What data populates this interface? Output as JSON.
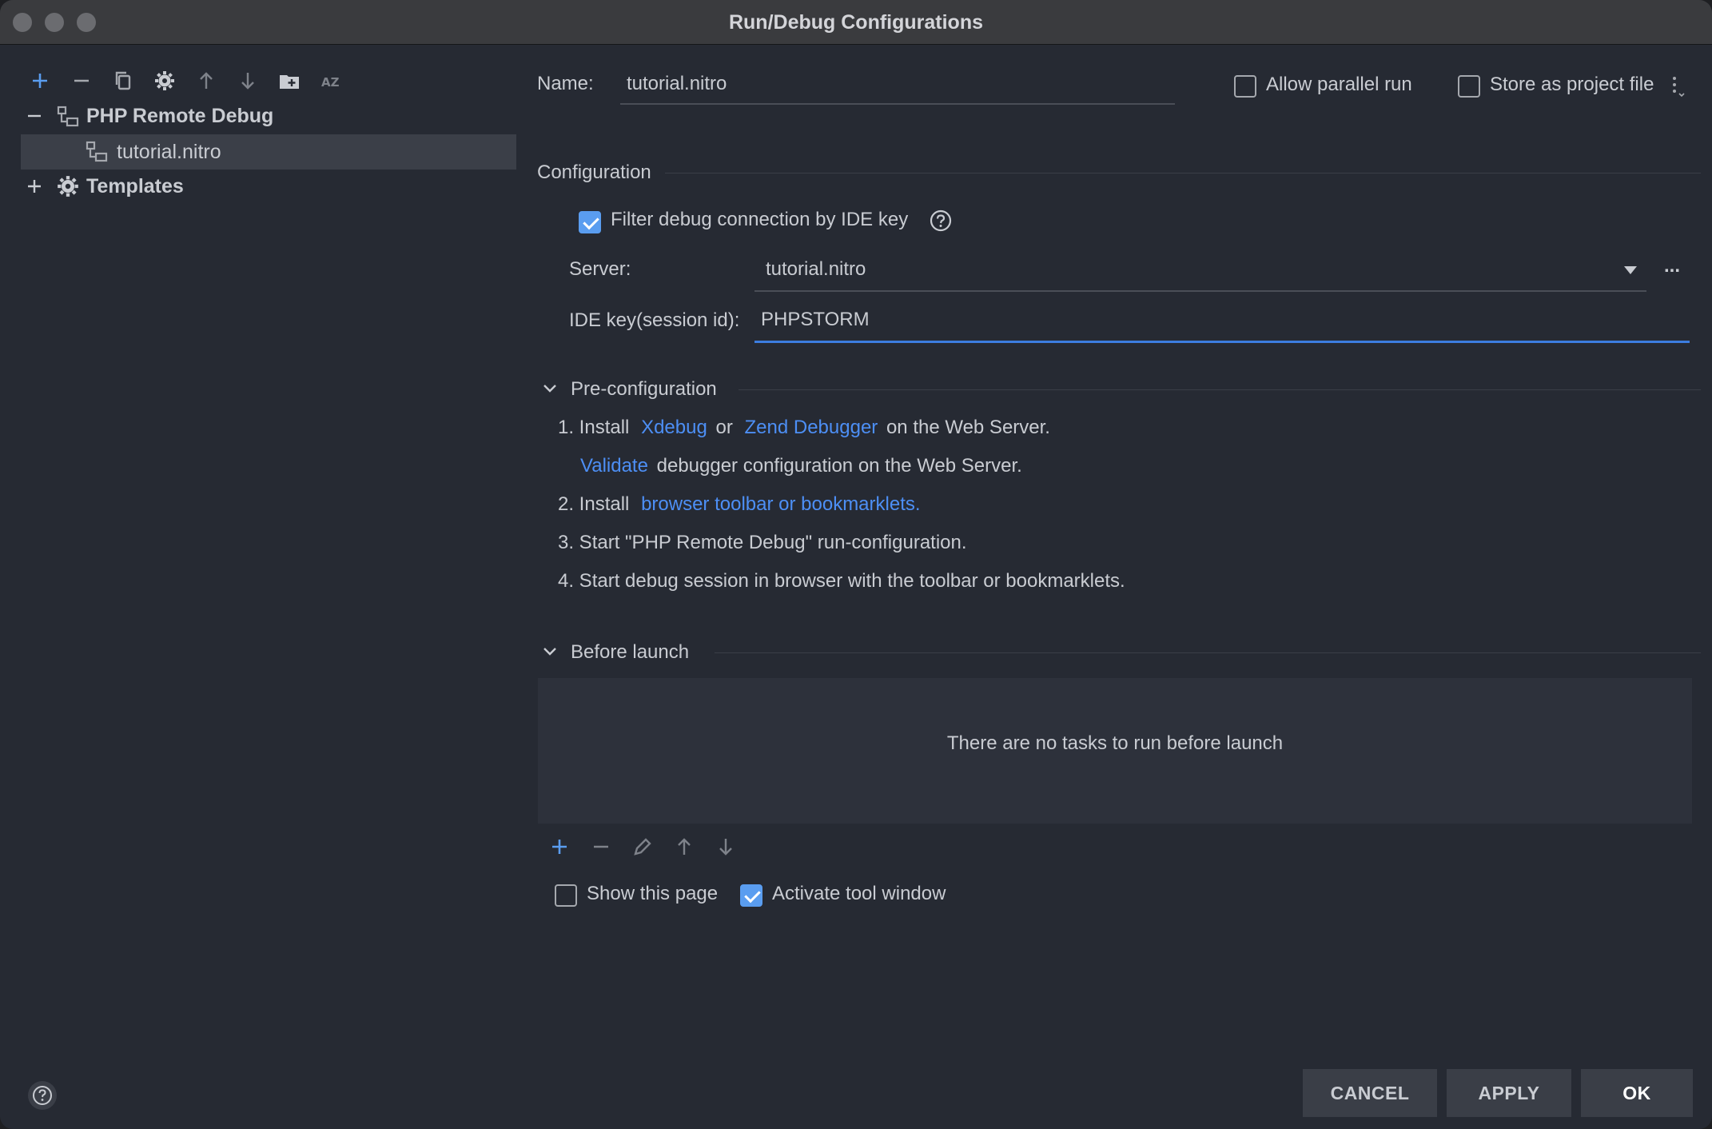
{
  "window": {
    "title": "Run/Debug Configurations"
  },
  "toolbar": {
    "icons": [
      "add-icon",
      "remove-icon",
      "copy-icon",
      "settings-icon",
      "move-up-icon",
      "move-down-icon",
      "new-folder-icon",
      "sort-alpha-icon"
    ]
  },
  "tree": {
    "group_label": "PHP Remote Debug",
    "item_label": "tutorial.nitro",
    "templates_label": "Templates"
  },
  "form": {
    "name_label": "Name:",
    "name_value": "tutorial.nitro",
    "allow_parallel_label": "Allow parallel run",
    "allow_parallel_checked": false,
    "store_project_label": "Store as project file",
    "store_project_checked": false,
    "configuration_title": "Configuration",
    "filter_label": "Filter debug connection by IDE key",
    "filter_checked": true,
    "server_label": "Server:",
    "server_value": "tutorial.nitro",
    "server_more": "...",
    "ide_key_label": "IDE key(session id):",
    "ide_key_value": "PHPSTORM"
  },
  "preconfig": {
    "title": "Pre-configuration",
    "step1_prefix": "1. Install",
    "step1_link1": "Xdebug",
    "step1_or": "or",
    "step1_link2": "Zend Debugger",
    "step1_suffix": "on the Web Server.",
    "validate_link": "Validate",
    "validate_text": "debugger configuration on the Web Server.",
    "step2_prefix": "2. Install",
    "step2_link": "browser toolbar or bookmarklets.",
    "step3": "3. Start \"PHP Remote Debug\" run-configuration.",
    "step4": "4. Start debug session in browser with the toolbar or bookmarklets."
  },
  "before_launch": {
    "title": "Before launch",
    "empty_text": "There are no tasks to run before launch",
    "show_page_label": "Show this page",
    "show_page_checked": false,
    "activate_label": "Activate tool window",
    "activate_checked": true
  },
  "buttons": {
    "cancel": "CANCEL",
    "apply": "APPLY",
    "ok": "OK"
  }
}
